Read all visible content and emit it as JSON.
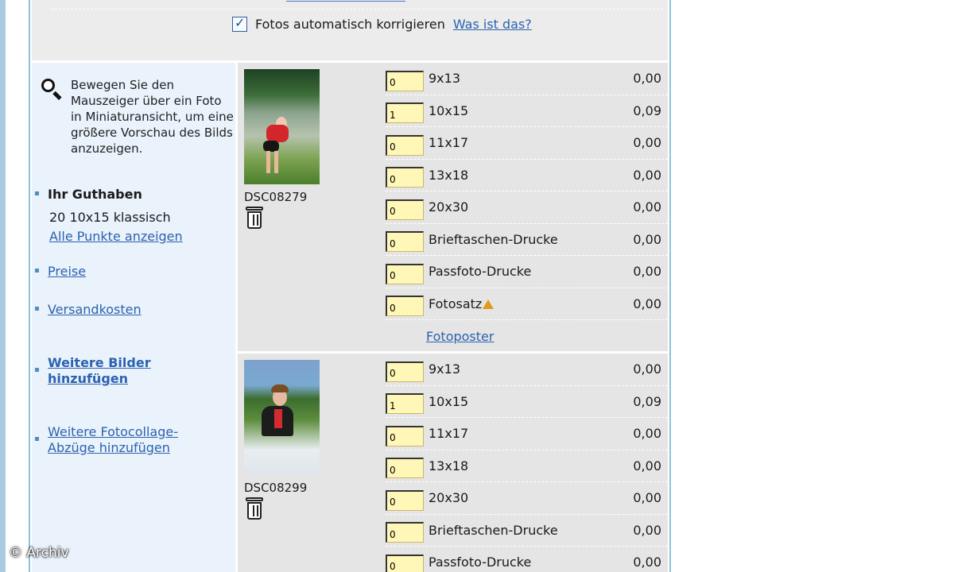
{
  "autofix": {
    "label": "Fotos automatisch korrigieren",
    "help_link": "Was ist das?"
  },
  "sidebar": {
    "hint": "Bewegen Sie den Mauszeiger über ein Foto in Miniaturansicht, um eine größere Vorschau des Bilds anzuzeigen.",
    "credit_title": "Ihr Guthaben",
    "credit_value": "20 10x15 klassisch",
    "credit_link": "Alle Punkte anzeigen",
    "prices_link": "Preise",
    "shipping_link": "Versandkosten",
    "add_images_link": "Weitere Bilder hinzufügen",
    "add_collage_link": "Weitere Fotocollage-Abzüge hinzufügen"
  },
  "photos": [
    {
      "name": "DSC08279",
      "poster_link": "Fotoposter",
      "rows": [
        {
          "qty": "0",
          "size": "9x13",
          "price": "0,00"
        },
        {
          "qty": "1",
          "size": "10x15",
          "price": "0,09"
        },
        {
          "qty": "0",
          "size": "11x17",
          "price": "0,00"
        },
        {
          "qty": "0",
          "size": "13x18",
          "price": "0,00"
        },
        {
          "qty": "0",
          "size": "20x30",
          "price": "0,00"
        },
        {
          "qty": "0",
          "size": "Brieftaschen-Drucke",
          "price": "0,00"
        },
        {
          "qty": "0",
          "size": "Passfoto-Drucke",
          "price": "0,00"
        },
        {
          "qty": "0",
          "size": "Fotosatz",
          "price": "0,00"
        }
      ]
    },
    {
      "name": "DSC08299",
      "rows": [
        {
          "qty": "0",
          "size": "9x13",
          "price": "0,00"
        },
        {
          "qty": "1",
          "size": "10x15",
          "price": "0,09"
        },
        {
          "qty": "0",
          "size": "11x17",
          "price": "0,00"
        },
        {
          "qty": "0",
          "size": "13x18",
          "price": "0,00"
        },
        {
          "qty": "0",
          "size": "20x30",
          "price": "0,00"
        },
        {
          "qty": "0",
          "size": "Brieftaschen-Drucke",
          "price": "0,00"
        },
        {
          "qty": "0",
          "size": "Passfoto-Drucke",
          "price": "0,00"
        }
      ]
    }
  ],
  "watermark": "© Archiv",
  "colors": {
    "link": "#2b63b0",
    "qty_field": "#fff7b8",
    "panel": "#e5e5e5",
    "sidebar": "#eaf2fb",
    "frame": "#8fc0de",
    "warning": "#e09a1e"
  },
  "icons": [
    "checkbox-icon",
    "magnifier-icon",
    "trash-icon",
    "warning-icon"
  ]
}
